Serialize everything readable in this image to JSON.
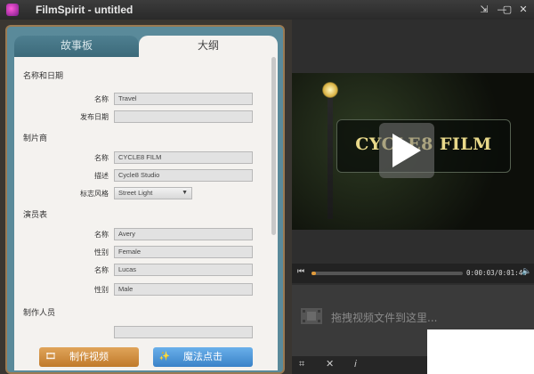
{
  "window": {
    "title": "FilmSpirit - untitled",
    "buttons": [
      "⇲",
      "—",
      "▢",
      "✕"
    ]
  },
  "tabs": [
    {
      "label": "故事板"
    },
    {
      "label": "大纲"
    }
  ],
  "form": {
    "section_name_date": "名称和日期",
    "name_label": "名称",
    "name_value": "Travel",
    "date_label": "发布日期",
    "date_value": "",
    "section_producer": "制片商",
    "producer_name_label": "名称",
    "producer_name_value": "CYCLE8 FILM",
    "producer_desc_label": "描述",
    "producer_desc_value": "Cycle8 Studio",
    "logo_style_label": "标志风格",
    "logo_style_value": "Street Light",
    "section_cast": "演员表",
    "cast": [
      {
        "name_label": "名称",
        "name": "Avery",
        "gender_label": "性别",
        "gender": "Female"
      },
      {
        "name_label": "名称",
        "name": "Lucas",
        "gender_label": "性别",
        "gender": "Male"
      }
    ],
    "section_staff": "制作人员"
  },
  "actions": {
    "make_video": "制作视频",
    "magic": "魔法点击"
  },
  "preview": {
    "sign_text": "CYCLE8 FILM",
    "time_current": "0:00:03",
    "time_total": "0:01:46",
    "time_display": "0:00:03/0:01:46",
    "progress_fraction": 0.03
  },
  "drop_zone": {
    "text": "拖拽视频文件到这里..."
  }
}
